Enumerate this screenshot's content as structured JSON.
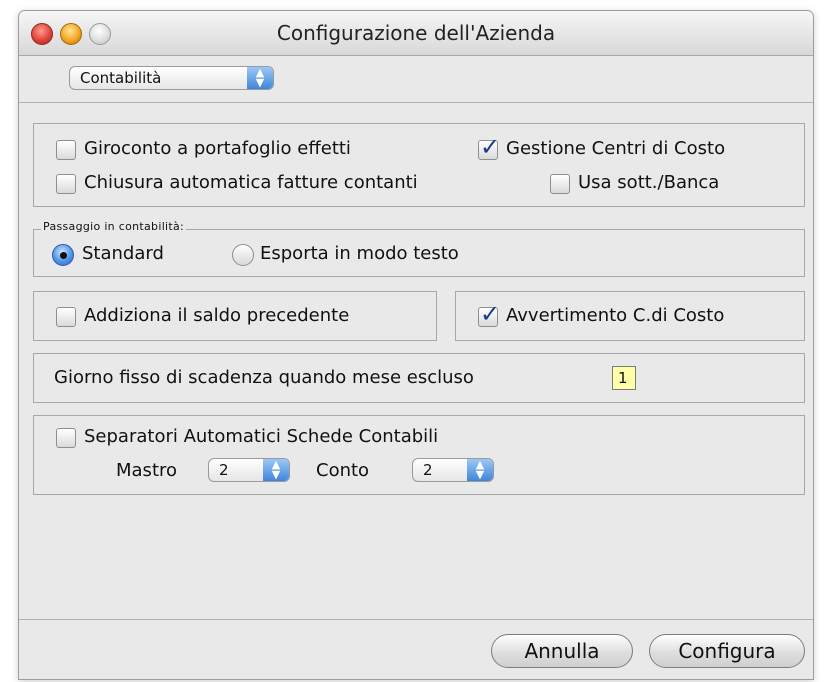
{
  "window": {
    "title": "Configurazione dell'Azienda"
  },
  "section_select": {
    "value": "Contabilità"
  },
  "options": {
    "giroconto": {
      "label": "Giroconto a portafoglio effetti",
      "checked": false
    },
    "gestione_centri": {
      "label": "Gestione Centri di Costo",
      "checked": true
    },
    "chiusura": {
      "label": "Chiusura automatica fatture contanti",
      "checked": false
    },
    "usa_sott": {
      "label": "Usa sott./Banca",
      "checked": false
    }
  },
  "passaggio": {
    "group_label": "Passaggio in contabilità:",
    "standard_label": "Standard",
    "esporta_label": "Esporta in modo testo",
    "selected": "Standard"
  },
  "addiziona": {
    "label": "Addiziona il saldo precedente",
    "checked": false
  },
  "avvertimento": {
    "label": "Avvertimento C.di Costo",
    "checked": true
  },
  "giorno_fisso": {
    "label": "Giorno fisso di scadenza quando mese escluso",
    "value": "1"
  },
  "separatori": {
    "label": "Separatori Automatici Schede Contabili",
    "checked": false,
    "mastro_label": "Mastro",
    "mastro_value": "2",
    "conto_label": "Conto",
    "conto_value": "2"
  },
  "buttons": {
    "annulla": "Annulla",
    "configura": "Configura"
  },
  "icons": {
    "check": "✓",
    "popup_arrows": "▲▼"
  },
  "colors": {
    "accent": "#3f86d9",
    "field_bg": "#ffffa8"
  }
}
